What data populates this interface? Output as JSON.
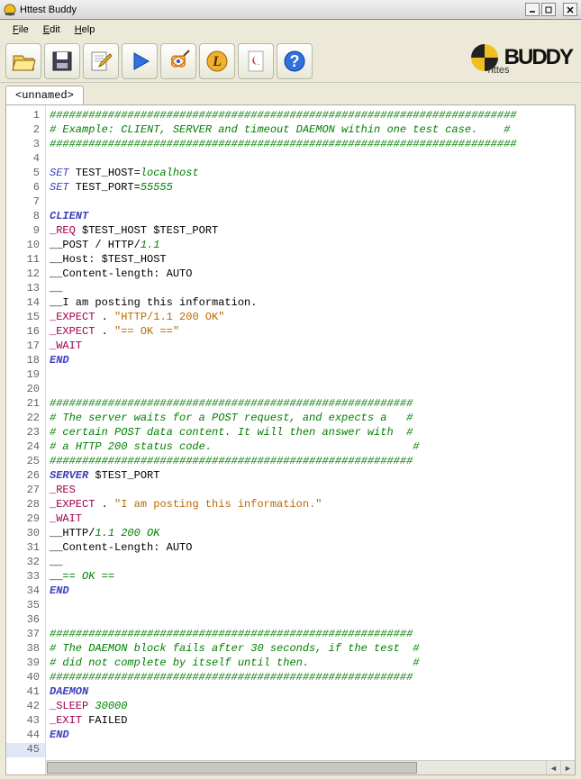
{
  "window": {
    "title": "Httest Buddy"
  },
  "menu": {
    "file": "File",
    "edit": "Edit",
    "help": "Help"
  },
  "toolbar": {
    "open": "open-icon",
    "save": "save-icon",
    "edit": "edit-icon",
    "run": "run-icon",
    "wand": "wand-icon",
    "ledger": "log-icon",
    "pdf": "pdf-icon",
    "help": "help-icon"
  },
  "logo": {
    "brand": "BUDDY",
    "sub": "httes"
  },
  "tab": "<unnamed>",
  "lines": [
    [
      [
        "c-comment",
        "########################################################################"
      ]
    ],
    [
      [
        "c-comment",
        "# Example: CLIENT, SERVER and timeout DAEMON within one test case.    #"
      ]
    ],
    [
      [
        "c-comment",
        "########################################################################"
      ]
    ],
    [
      [
        "",
        ""
      ]
    ],
    [
      [
        "c-kw",
        "SET"
      ],
      [
        "",
        " TEST_HOST="
      ],
      [
        "c-dn",
        "localhost"
      ]
    ],
    [
      [
        "c-kw",
        "SET"
      ],
      [
        "",
        " TEST_PORT="
      ],
      [
        "c-dn",
        "55555"
      ]
    ],
    [
      [
        "",
        ""
      ]
    ],
    [
      [
        "c-kw2",
        "CLIENT"
      ]
    ],
    [
      [
        "c-cmd",
        "_REQ"
      ],
      [
        "",
        " $TEST_HOST $TEST_PORT"
      ]
    ],
    [
      [
        "",
        "__POST / HTTP/"
      ],
      [
        "c-num",
        "1.1"
      ]
    ],
    [
      [
        "",
        "__Host: $TEST_HOST"
      ]
    ],
    [
      [
        "",
        "__Content-length: AUTO"
      ]
    ],
    [
      [
        "",
        "__"
      ]
    ],
    [
      [
        "",
        "__I am posting this information."
      ]
    ],
    [
      [
        "c-cmd",
        "_EXPECT"
      ],
      [
        "",
        " . "
      ],
      [
        "c-str",
        "\"HTTP/1.1 200 OK\""
      ]
    ],
    [
      [
        "c-cmd",
        "_EXPECT"
      ],
      [
        "",
        " . "
      ],
      [
        "c-str",
        "\"== OK ==\""
      ]
    ],
    [
      [
        "c-cmd",
        "_WAIT"
      ]
    ],
    [
      [
        "c-kw2",
        "END"
      ]
    ],
    [
      [
        "",
        ""
      ]
    ],
    [
      [
        "",
        ""
      ]
    ],
    [
      [
        "c-comment",
        "########################################################"
      ]
    ],
    [
      [
        "c-comment",
        "# The server waits for a POST request, and expects a   #"
      ]
    ],
    [
      [
        "c-comment",
        "# certain POST data content. It will then answer with  #"
      ]
    ],
    [
      [
        "c-comment",
        "# a HTTP 200 status code.                               #"
      ]
    ],
    [
      [
        "c-comment",
        "########################################################"
      ]
    ],
    [
      [
        "c-kw2",
        "SERVER"
      ],
      [
        "",
        " $TEST_PORT"
      ]
    ],
    [
      [
        "c-cmd",
        "_RES"
      ]
    ],
    [
      [
        "c-cmd",
        "_EXPECT"
      ],
      [
        "",
        " . "
      ],
      [
        "c-str",
        "\"I am posting this information.\""
      ]
    ],
    [
      [
        "c-cmd",
        "_WAIT"
      ]
    ],
    [
      [
        "",
        "__HTTP/"
      ],
      [
        "c-num",
        "1.1 200 OK"
      ]
    ],
    [
      [
        "",
        "__Content-Length: AUTO"
      ]
    ],
    [
      [
        "",
        "__"
      ]
    ],
    [
      [
        "",
        "__"
      ],
      [
        "c-num",
        "== OK =="
      ]
    ],
    [
      [
        "c-kw2",
        "END"
      ]
    ],
    [
      [
        "",
        ""
      ]
    ],
    [
      [
        "",
        ""
      ]
    ],
    [
      [
        "c-comment",
        "########################################################"
      ]
    ],
    [
      [
        "c-comment",
        "# The DAEMON block fails after 30 seconds, if the test  #"
      ]
    ],
    [
      [
        "c-comment",
        "# did not complete by itself until then.                #"
      ]
    ],
    [
      [
        "c-comment",
        "########################################################"
      ]
    ],
    [
      [
        "c-kw2",
        "DAEMON"
      ]
    ],
    [
      [
        "c-cmd",
        "_SLEEP"
      ],
      [
        "",
        " "
      ],
      [
        "c-num",
        "30000"
      ]
    ],
    [
      [
        "c-cmd",
        "_EXIT"
      ],
      [
        "",
        " FAILED"
      ]
    ],
    [
      [
        "c-kw2",
        "END"
      ]
    ],
    [
      [
        "",
        ""
      ]
    ]
  ],
  "currentLine": 45
}
